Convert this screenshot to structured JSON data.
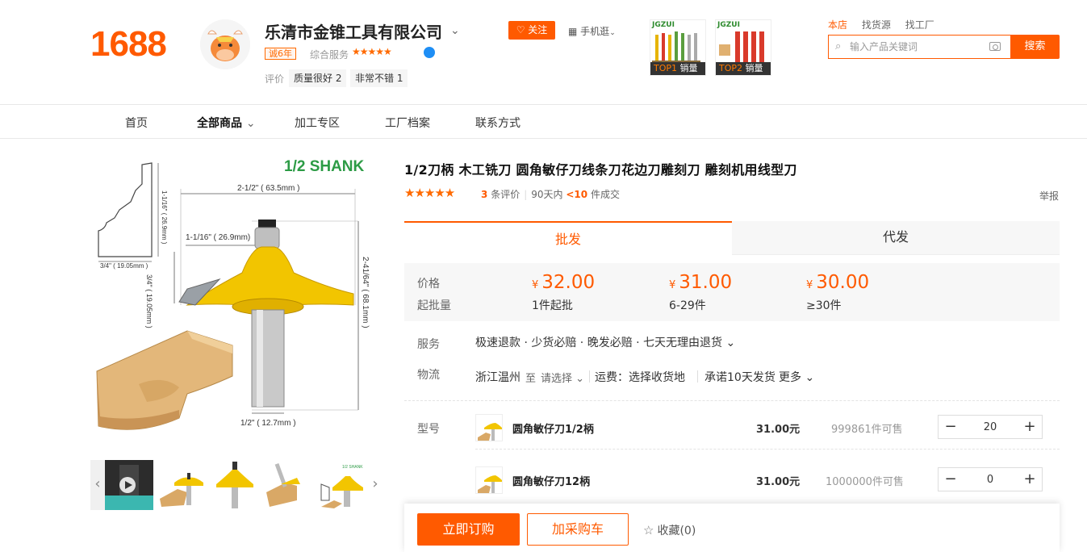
{
  "header": {
    "logo": "1688",
    "company_name": "乐清市金锥工具有限公司",
    "years_badge": "诚6年",
    "service_label": "综合服务",
    "service_stars": "★★★★★",
    "review_label": "评价",
    "review_tags": [
      "质量很好 2",
      "非常不错 1"
    ],
    "follow_label": "关注",
    "mobile_label": "手机逛",
    "top_products": [
      {
        "brand": "JGZUI",
        "rank": "TOP1",
        "label": "销量"
      },
      {
        "brand": "JGZUI",
        "rank": "TOP2",
        "label": "销量"
      }
    ],
    "search_tabs": [
      "本店",
      "找货源",
      "找工厂"
    ],
    "search_placeholder": "输入产品关键词",
    "search_button": "搜索"
  },
  "nav": {
    "items": [
      "首页",
      "全部商品",
      "加工专区",
      "工厂档案",
      "联系方式"
    ]
  },
  "gallery": {
    "shank_label": "1/2 SHANK",
    "dims": {
      "d1": "2-1/2\" ( 63.5mm )",
      "d2": "1-1/16\" ( 26.9mm)",
      "d3": "3/4\" ( 19.05mm )",
      "d4": "2-41/64\" ( 68.1mm )",
      "d5": "1/2\" ( 12.7mm )",
      "d6": "3/4\" ( 19.05mm )",
      "d7": "1-1/16\" ( 26.9mm )"
    }
  },
  "product": {
    "title": "1/2刀柄 木工铣刀 圆角敏仔刀线条刀花边刀雕刻刀 雕刻机用线型刀",
    "rating_stars": "★★★★★",
    "review_count": "3",
    "review_suffix": "条评价",
    "sales_period": "90天内",
    "sales_count": "<10",
    "sales_suffix": "件成交",
    "report_label": "举报",
    "tabs": {
      "wholesale": "批发",
      "dropship": "代发"
    }
  },
  "pricing": {
    "price_label": "价格",
    "moq_label": "起批量",
    "currency": "¥",
    "tiers": [
      {
        "price": "32.00",
        "moq": "1件起批"
      },
      {
        "price": "31.00",
        "moq": "6-29件"
      },
      {
        "price": "30.00",
        "moq": "≥30件"
      }
    ]
  },
  "service": {
    "label": "服务",
    "text": "极速退款 · 少货必赔 · 晚发必赔 · 七天无理由退货 ⌄"
  },
  "logistics": {
    "label": "物流",
    "origin": "浙江温州",
    "to_label": "至",
    "select_label": "请选择",
    "shipping": "运费：选择收货地",
    "promise": "承诺10天发货",
    "more": "更多"
  },
  "sku": {
    "label": "型号",
    "rows": [
      {
        "name": "圆角敏仔刀1/2柄",
        "price": "31.00元",
        "stock": "999861件可售",
        "qty": "20"
      },
      {
        "name": "圆角敏仔刀12柄",
        "price": "31.00元",
        "stock": "1000000件可售",
        "qty": "0"
      }
    ]
  },
  "actions": {
    "buy": "立即订购",
    "cart": "加采购车",
    "favorite": "收藏(0)"
  },
  "colors": {
    "brand": "#ff5a00",
    "router_yellow": "#f2c500",
    "shank_green": "#2c9b45"
  }
}
